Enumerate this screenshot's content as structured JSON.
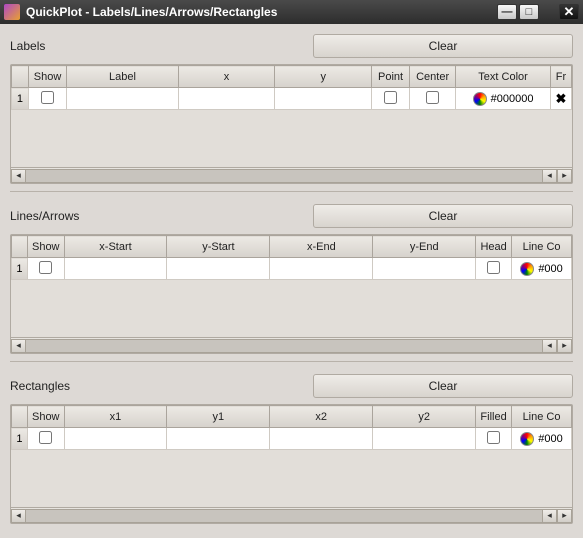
{
  "window": {
    "title": "QuickPlot - Labels/Lines/Arrows/Rectangles"
  },
  "labels": {
    "title": "Labels",
    "clear": "Clear",
    "columns": {
      "show": "Show",
      "label": "Label",
      "x": "x",
      "y": "y",
      "point": "Point",
      "center": "Center",
      "textcolor": "Text Color",
      "fr": "Fr"
    },
    "rows": [
      {
        "n": "1",
        "color": "#000000",
        "fr": "✖"
      }
    ]
  },
  "lines": {
    "title": "Lines/Arrows",
    "clear": "Clear",
    "columns": {
      "show": "Show",
      "xstart": "x-Start",
      "ystart": "y-Start",
      "xend": "x-End",
      "yend": "y-End",
      "head": "Head",
      "linecolor": "Line Co"
    },
    "rows": [
      {
        "n": "1",
        "color": "#000"
      }
    ]
  },
  "rects": {
    "title": "Rectangles",
    "clear": "Clear",
    "columns": {
      "show": "Show",
      "x1": "x1",
      "y1": "y1",
      "x2": "x2",
      "y2": "y2",
      "filled": "Filled",
      "linecolor": "Line Co"
    },
    "rows": [
      {
        "n": "1",
        "color": "#000"
      }
    ]
  }
}
